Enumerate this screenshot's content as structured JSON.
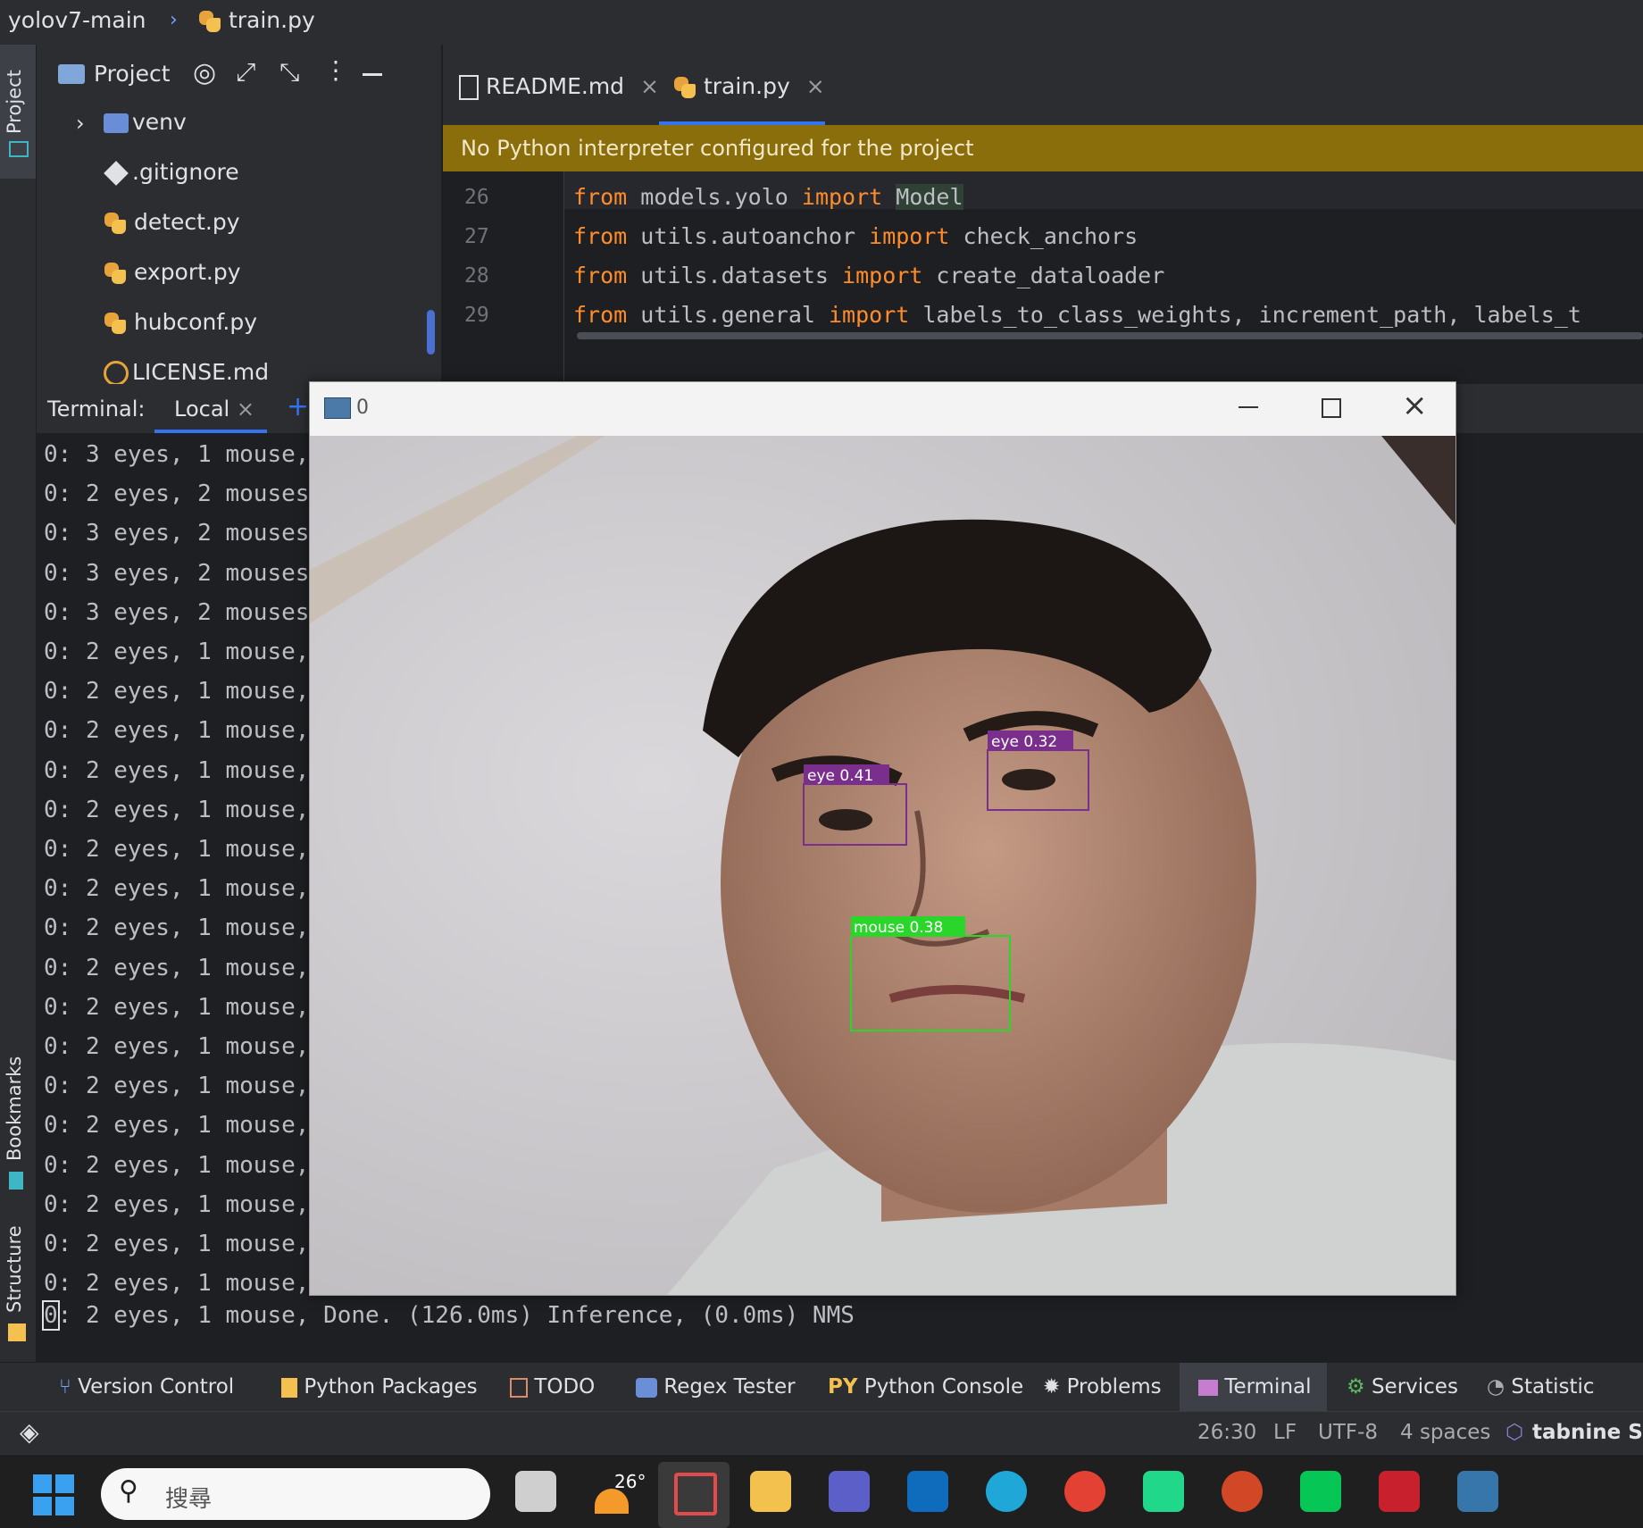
{
  "titlebar": {
    "project": "yolov7-main",
    "file": "train.py"
  },
  "leftstrip": {
    "project_label": "Project",
    "bookmarks_label": "Bookmarks",
    "structure_label": "Structure"
  },
  "project_panel": {
    "title": "Project",
    "items": [
      {
        "label": "venv",
        "icon": "folder-venv-icon"
      },
      {
        "label": ".gitignore",
        "icon": "git-icon"
      },
      {
        "label": "detect.py",
        "icon": "python-file-icon"
      },
      {
        "label": "export.py",
        "icon": "python-file-icon"
      },
      {
        "label": "hubconf.py",
        "icon": "python-file-icon"
      },
      {
        "label": "LICENSE.md",
        "icon": "license-icon"
      }
    ]
  },
  "editor": {
    "tabs": [
      {
        "label": "README.md"
      },
      {
        "label": "train.py"
      }
    ],
    "banner": "No Python interpreter configured for the project",
    "lines": [
      {
        "num": "26",
        "k1": "from",
        "mod": " models.yolo ",
        "k2": "import",
        "rest": " ",
        "hl": "Model"
      },
      {
        "num": "27",
        "k1": "from",
        "mod": " utils.autoanchor ",
        "k2": "import",
        "rest": " check_anchors",
        "hl": ""
      },
      {
        "num": "28",
        "k1": "from",
        "mod": " utils.datasets ",
        "k2": "import",
        "rest": " create_dataloader",
        "hl": ""
      },
      {
        "num": "29",
        "k1": "from",
        "mod": " utils.general ",
        "k2": "import",
        "rest": " labels_to_class_weights, increment_path, labels_t",
        "hl": ""
      }
    ]
  },
  "terminal": {
    "label": "Terminal:",
    "tab": "Local",
    "lines": [
      "0: 3 eyes, 1 mouse,",
      "0: 2 eyes, 2 mouses",
      "0: 3 eyes, 2 mouses",
      "0: 3 eyes, 2 mouses",
      "0: 3 eyes, 2 mouses",
      "0: 2 eyes, 1 mouse,",
      "0: 2 eyes, 1 mouse,",
      "0: 2 eyes, 1 mouse,",
      "0: 2 eyes, 1 mouse,",
      "0: 2 eyes, 1 mouse,",
      "0: 2 eyes, 1 mouse,",
      "0: 2 eyes, 1 mouse,",
      "0: 2 eyes, 1 mouse,",
      "0: 2 eyes, 1 mouse,",
      "0: 2 eyes, 1 mouse,",
      "0: 2 eyes, 1 mouse,",
      "0: 2 eyes, 1 mouse,",
      "0: 2 eyes, 1 mouse,",
      "0: 2 eyes, 1 mouse,",
      "0: 2 eyes, 1 mouse,",
      "0: 2 eyes, 1 mouse,",
      "0: 2 eyes, 1 mouse,"
    ],
    "last_line": ": 2 eyes, 1 mouse, Done. (126.0ms) Inference, (0.0ms) NMS",
    "cursor_char": "0"
  },
  "popup": {
    "title": "0",
    "detections": [
      {
        "label": "eye 0.41",
        "color": "#7b2f8c"
      },
      {
        "label": "eye 0.32",
        "color": "#7b2f8c"
      },
      {
        "label": "mouse 0.38",
        "color": "#2bd62b"
      }
    ]
  },
  "toolbar": {
    "items": [
      "Version Control",
      "Python Packages",
      "TODO",
      "Regex Tester",
      "Python Console",
      "Problems",
      "Terminal",
      "Services",
      "Statistic"
    ]
  },
  "statusbar": {
    "position": "26:30",
    "line_sep": "LF",
    "encoding": "UTF-8",
    "indent": "4 spaces",
    "plugin": "tabnine S"
  },
  "taskbar": {
    "search_placeholder": "搜尋",
    "weather": "26°"
  },
  "colors": {
    "accent": "#3574f0",
    "banner": "#8a6e0c",
    "keyword": "#ff8c2b"
  }
}
